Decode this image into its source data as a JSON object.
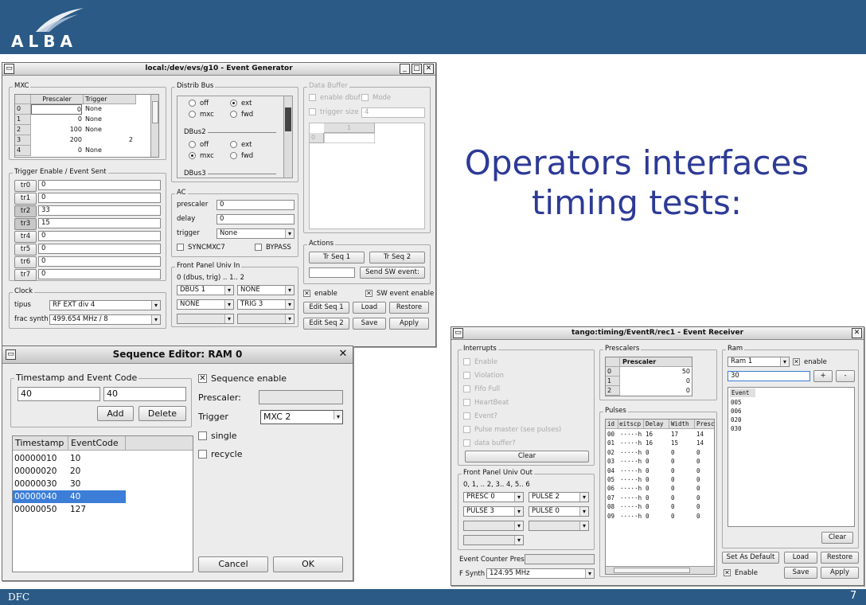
{
  "slide": {
    "logo": "ALBA",
    "title_lines": [
      "Operators interfaces",
      "timing tests:"
    ],
    "footer": "DFC",
    "page": "7",
    "brand_color": "#2b5a86",
    "title_color": "#2d3a96"
  },
  "eg": {
    "title": "local:/dev/evs/g10  -  Event Generator",
    "mxc": {
      "label": "MXC",
      "headers": [
        "",
        "Prescaler",
        "Trigger"
      ],
      "rows": [
        [
          "0",
          "0",
          "None"
        ],
        [
          "1",
          "0",
          "None"
        ],
        [
          "2",
          "100",
          "None"
        ],
        [
          "3",
          "200",
          "2"
        ],
        [
          "4",
          "0",
          "None"
        ]
      ]
    },
    "trig": {
      "label": "Trigger Enable / Event Sent",
      "rows": [
        [
          "tr0",
          "0"
        ],
        [
          "tr1",
          "0"
        ],
        [
          "tr2",
          "33"
        ],
        [
          "tr3",
          "15"
        ],
        [
          "tr4",
          "0"
        ],
        [
          "tr5",
          "0"
        ],
        [
          "tr6",
          "0"
        ],
        [
          "tr7",
          "0"
        ]
      ]
    },
    "clock": {
      "label": "Clock",
      "tipus_label": "tipus",
      "tipus": "RF EXT div 4",
      "frac_label": "frac synth",
      "frac": "499.654 MHz / 8"
    },
    "distrib": {
      "label": "Distrib Bus",
      "off": "off",
      "ext": "ext",
      "mxc": "mxc",
      "fwd": "fwd",
      "dbus2": "DBus2",
      "dbus3": "DBus3"
    },
    "ac": {
      "label": "AC",
      "prescaler_label": "prescaler",
      "prescaler": "0",
      "delay_label": "delay",
      "delay": "0",
      "trigger_label": "trigger",
      "trigger": "None",
      "sync": "SYNCMXC7",
      "bypass": "BYPASS"
    },
    "fp": {
      "label": "Front Panel Univ In",
      "hint": "0 (dbus, trig) .. 1.. 2",
      "r1a": "DBUS 1",
      "r1b": "NONE",
      "r2a": "NONE",
      "r2b": "TRIG 3"
    },
    "buffer": {
      "label": "Data Buffer",
      "enable": "enable dbuf",
      "mode": "Mode",
      "trigger": "trigger",
      "size_label": "size",
      "size": "4",
      "col": "1",
      "row": "0"
    },
    "actions": {
      "label": "Actions",
      "tr1": "Tr Seq 1",
      "tr2": "Tr Seq 2",
      "send": "Send SW event:"
    },
    "bottom": {
      "enable": "enable",
      "swenable": "SW event enable",
      "edit1": "Edit Seq 1",
      "load": "Load",
      "restore": "Restore",
      "edit2": "Edit Seq 2",
      "save": "Save",
      "apply": "Apply"
    }
  },
  "se": {
    "title": "Sequence Editor: RAM 0",
    "group": "Timestamp and Event Code",
    "ts": "40",
    "ev": "40",
    "add": "Add",
    "delete": "Delete",
    "headers": [
      "Timestamp",
      "EventCode"
    ],
    "rows": [
      [
        "00000010",
        "10"
      ],
      [
        "00000020",
        "20"
      ],
      [
        "00000030",
        "30"
      ],
      [
        "00000040",
        "40"
      ],
      [
        "00000050",
        "127"
      ]
    ],
    "seq_enable": "Sequence enable",
    "prescaler": "Prescaler:",
    "trigger": "Trigger",
    "trigger_val": "MXC 2",
    "single": "single",
    "recycle": "recycle",
    "cancel": "Cancel",
    "ok": "OK"
  },
  "er": {
    "title": "tango:timing/EventR/rec1  -  Event Receiver",
    "interrupts": {
      "label": "Interrupts",
      "items": [
        "Enable",
        "Violation",
        "Fifo Full",
        "HeartBeat",
        "Event?",
        "Pulse master (see pulses)",
        "data buffer?"
      ],
      "clear": "Clear"
    },
    "prescalers": {
      "label": "Prescalers",
      "header": "Prescaler",
      "rows": [
        [
          "0",
          "50"
        ],
        [
          "1",
          "0"
        ],
        [
          "2",
          "0"
        ]
      ]
    },
    "pulses": {
      "label": "Pulses",
      "headers": [
        "id",
        "eitscp",
        "Delay",
        "Width",
        "Presc"
      ],
      "rows": [
        [
          "00",
          "·····h",
          "16",
          "17",
          "14"
        ],
        [
          "01",
          "·····h",
          "16",
          "15",
          "14"
        ],
        [
          "02",
          "·····h",
          "0",
          "0",
          "0"
        ],
        [
          "03",
          "·····h",
          "0",
          "0",
          "0"
        ],
        [
          "04",
          "·····h",
          "0",
          "0",
          "0"
        ],
        [
          "05",
          "·····h",
          "0",
          "0",
          "0"
        ],
        [
          "06",
          "·····h",
          "0",
          "0",
          "0"
        ],
        [
          "07",
          "·····h",
          "0",
          "0",
          "0"
        ],
        [
          "08",
          "·····h",
          "0",
          "0",
          "0"
        ],
        [
          "09",
          "·····h",
          "0",
          "0",
          "0"
        ]
      ]
    },
    "fpout": {
      "label": "Front Panel Univ Out",
      "hint": "0, 1, .. 2, 3.. 4, 5.. 6",
      "a1": "PRESC 0",
      "b1": "PULSE 2",
      "a2": "PULSE 3",
      "b2": "PULSE 0"
    },
    "counter_label": "Event Counter Presc",
    "fsynth_label": "F Synth",
    "fsynth": "124.95 MHz",
    "ram": {
      "label": "Ram",
      "sel": "Ram 1",
      "enable": "enable",
      "value": "30",
      "plus": "+",
      "minus": "-",
      "list_header": "Event",
      "items": [
        "005",
        "006",
        "020",
        "030"
      ],
      "clear": "Clear"
    },
    "setdefault": "Set As Default",
    "load": "Load",
    "restore": "Restore",
    "enable": "Enable",
    "save": "Save",
    "apply": "Apply"
  }
}
